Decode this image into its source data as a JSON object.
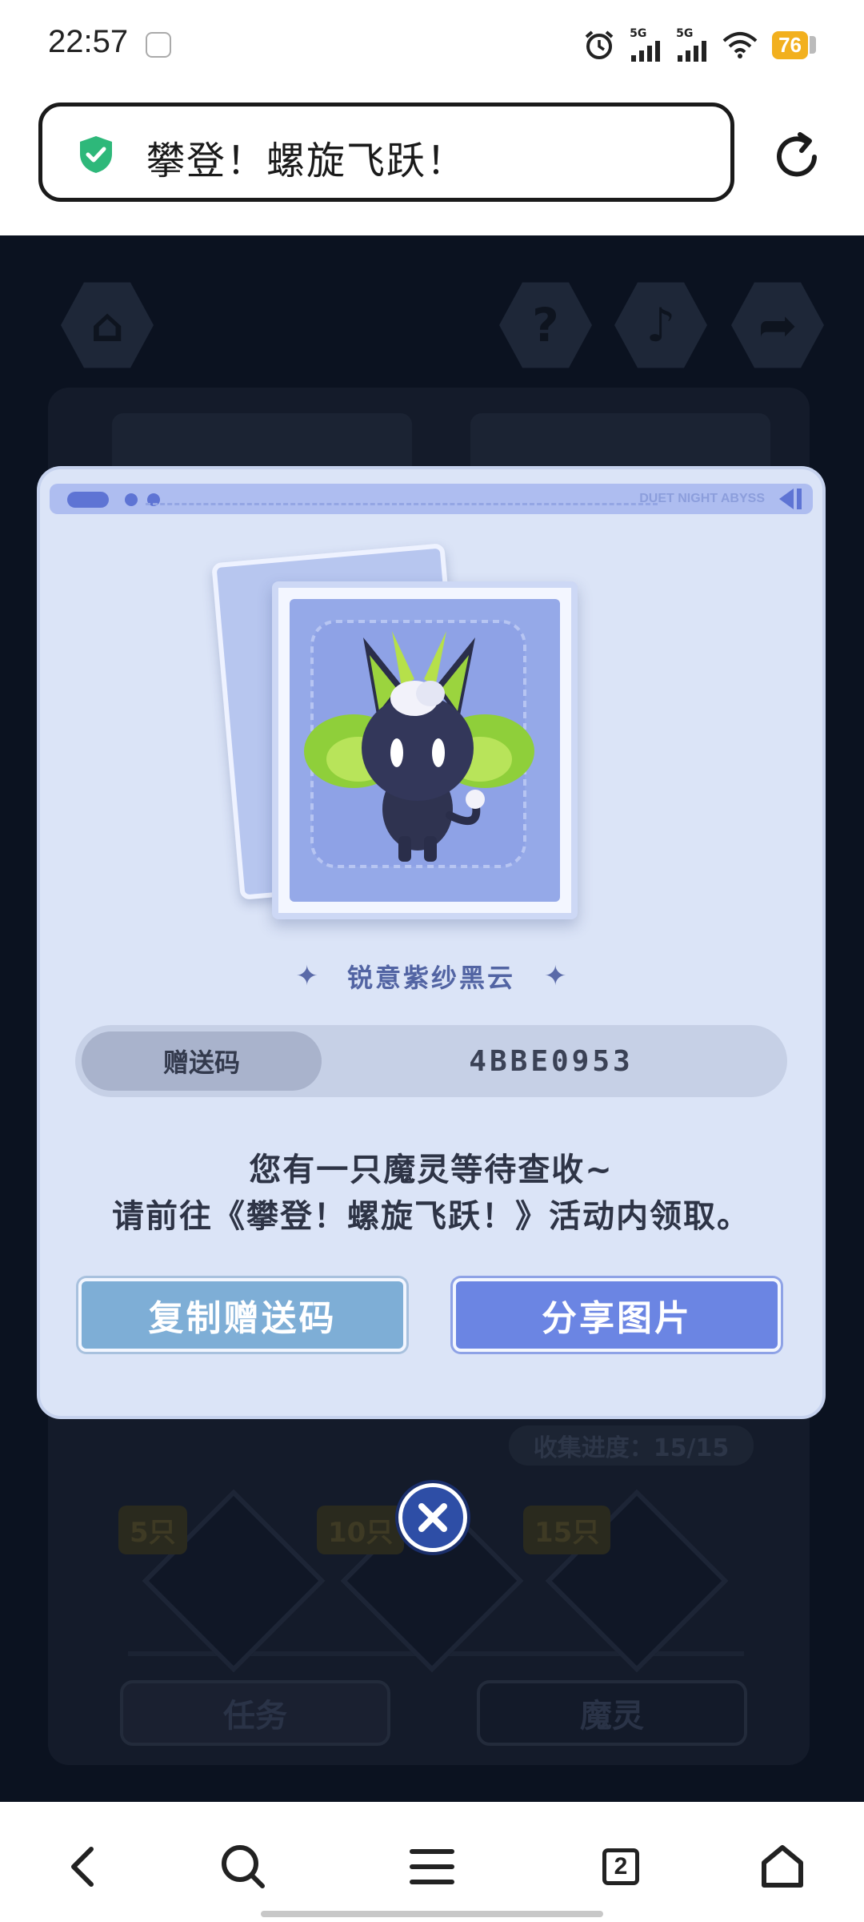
{
  "status_bar": {
    "time": "22:57",
    "network_1": "5G",
    "network_2": "5G",
    "battery": "76"
  },
  "browser": {
    "page_title": "攀登！螺旋飞跃！",
    "tab_count": "2"
  },
  "background": {
    "progress_text": "收集进度：15/15",
    "milestones": [
      "5只",
      "10只",
      "15只"
    ],
    "tasks_button": "任务",
    "spirits_button": "魔灵"
  },
  "modal": {
    "header_brand": "DUET NIGHT ABYSS",
    "spirit_name": "锐意紫纱黑云",
    "gift_code_label": "赠送码",
    "gift_code_value": "4BBE0953",
    "message_line1": "您有一只魔灵等待查收~",
    "message_line2": "请前往《攀登！螺旋飞跃！》活动内领取。",
    "copy_button": "复制赠送码",
    "share_button": "分享图片"
  },
  "colors": {
    "modal_bg": "#dbe4f7",
    "copy_button": "#7eaed6",
    "share_button": "#6b85e3",
    "secure_green": "#2eb87a"
  }
}
